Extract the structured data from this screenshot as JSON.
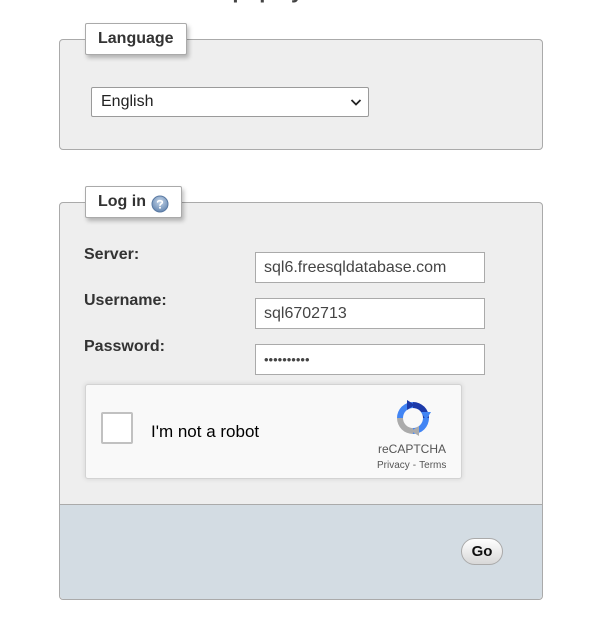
{
  "header": {
    "title": "phpMyAdmin"
  },
  "language": {
    "legend": "Language",
    "selected": "English"
  },
  "login": {
    "legend": "Log in",
    "server_label": "Server:",
    "server_value": "sql6.freesqldatabase.com",
    "username_label": "Username:",
    "username_value": "sql6702713",
    "password_label": "Password:",
    "password_value": "••••••••••"
  },
  "recaptcha": {
    "label": "I'm not a robot",
    "brand": "reCAPTCHA",
    "privacy": "Privacy",
    "separator": "-",
    "terms": "Terms"
  },
  "footer": {
    "go_label": "Go"
  }
}
